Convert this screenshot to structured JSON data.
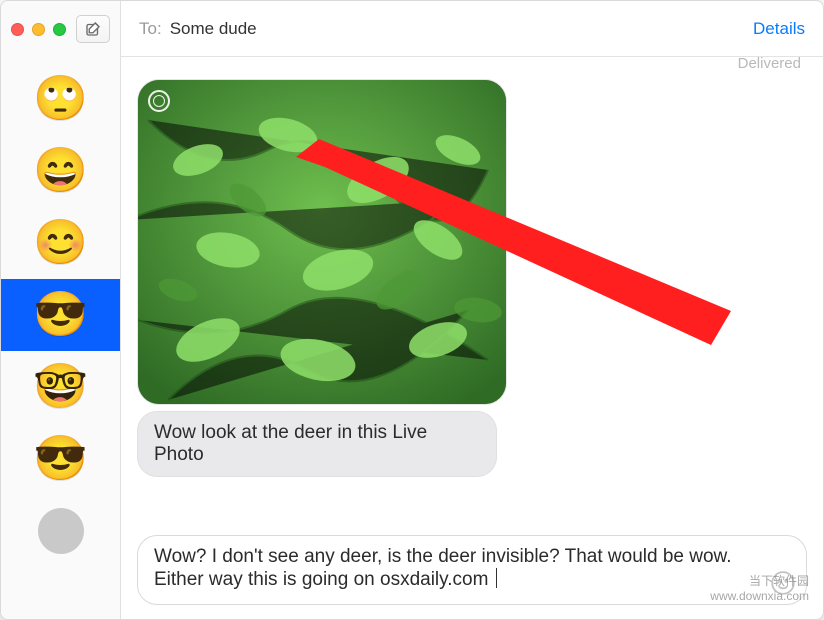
{
  "header": {
    "to_label": "To:",
    "recipient": "Some dude",
    "details": "Details"
  },
  "status": {
    "delivered": "Delivered"
  },
  "sidebar": {
    "items": [
      {
        "emoji": "🙄"
      },
      {
        "emoji": "😄"
      },
      {
        "emoji": "😊"
      },
      {
        "emoji": "😎"
      },
      {
        "emoji": "🤓"
      },
      {
        "emoji": "😎"
      }
    ],
    "selected_index": 3
  },
  "messages": {
    "incoming_text": "Wow look at the deer in this Live Photo"
  },
  "composer": {
    "text": "Wow? I don't see any deer, is the deer invisible? That would be wow. Either way this is going on osxdaily.com "
  },
  "watermark": {
    "line1": "当下软件园",
    "line2": "www.downxia.com"
  },
  "annotation": {
    "arrow_color": "#ff1f1f"
  }
}
